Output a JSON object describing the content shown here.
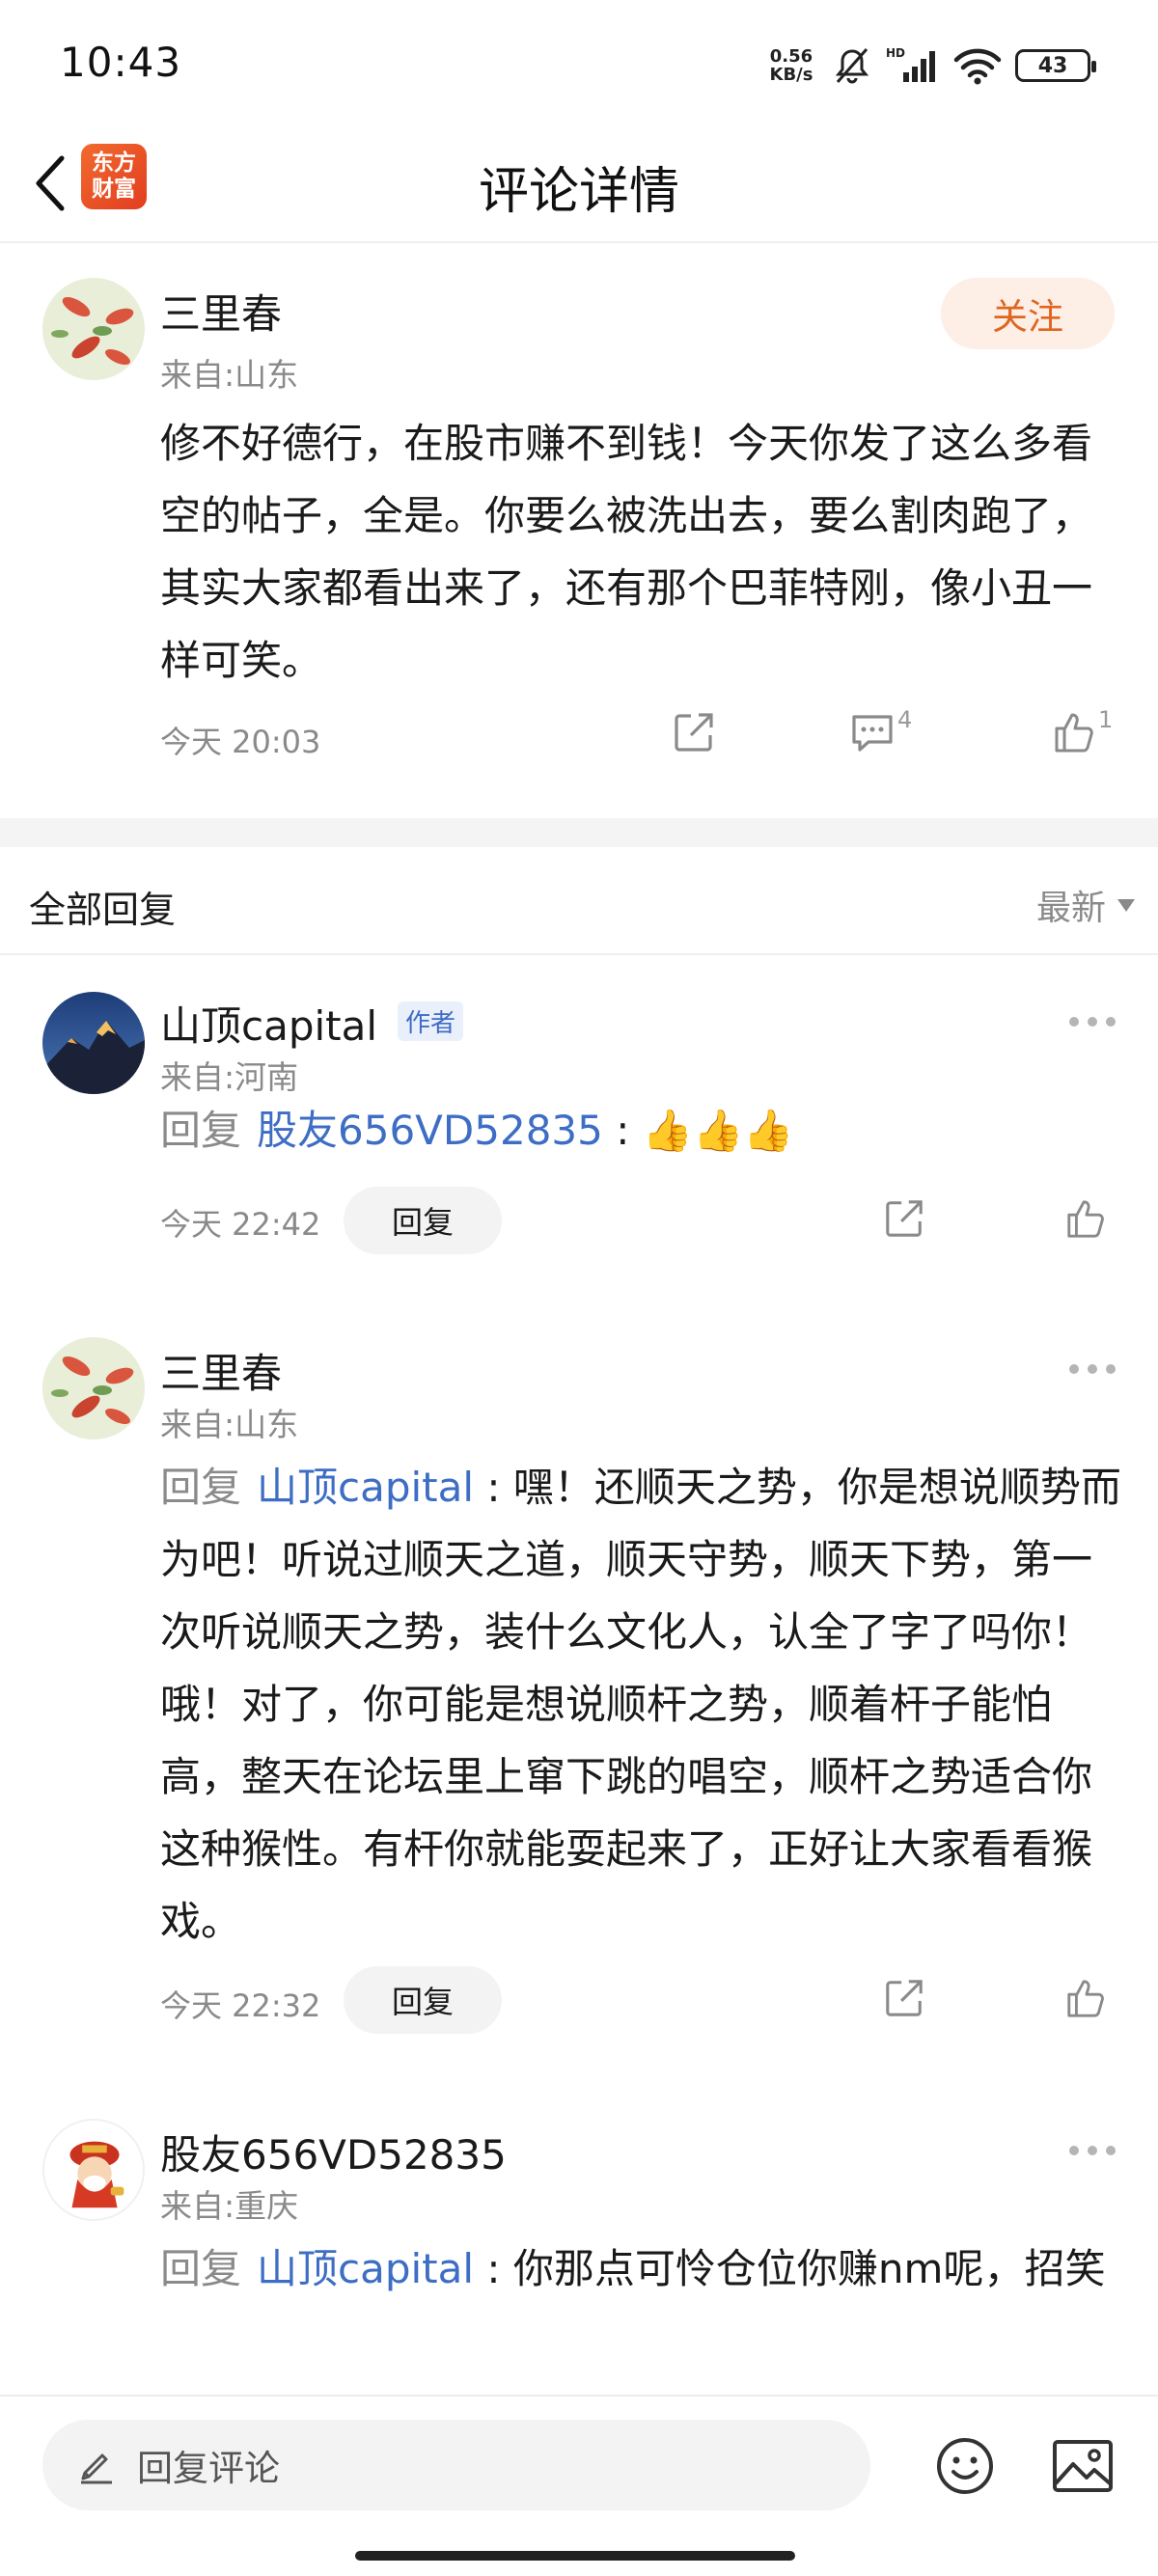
{
  "status": {
    "time": "10:43",
    "net_speed_value": "0.56",
    "net_speed_unit": "KB/s",
    "battery": "43"
  },
  "header": {
    "title": "评论详情",
    "logo_line1": "东方",
    "logo_line2": "财富"
  },
  "main_comment": {
    "author": "三里春",
    "location": "来自:山东",
    "follow_label": "关注",
    "text": "修不好德行，在股市赚不到钱！今天你发了这么多看空的帖子，全是。你要么被洗出去，要么割肉跑了，其实大家都看出来了，还有那个巴菲特刚，像小丑一样可笑。",
    "time": "今天 20:03",
    "comment_count": "4",
    "like_count": "1"
  },
  "replies_header": {
    "title": "全部回复",
    "sort_label": "最新"
  },
  "replies": [
    {
      "author": "山顶capital",
      "badge": "作者",
      "location": "来自:河南",
      "reply_word": "回复",
      "reply_to": "股友656VD52835",
      "content": "👍👍👍",
      "time": "今天 22:42",
      "reply_button": "回复"
    },
    {
      "author": "三里春",
      "location": "来自:山东",
      "reply_word": "回复",
      "reply_to": "山顶capital",
      "content": "嘿！还顺天之势，你是想说顺势而为吧！听说过顺天之道，顺天守势，顺天下势，第一次听说顺天之势，装什么文化人，认全了字了吗你！ 哦！对了，你可能是想说顺杆之势，顺着杆子能怕高，整天在论坛里上窜下跳的唱空，顺杆之势适合你这种猴性。有杆你就能耍起来了，正好让大家看看猴戏。",
      "time": "今天 22:32",
      "reply_button": "回复"
    },
    {
      "author": "股友656VD52835",
      "location": "来自:重庆",
      "reply_word": "回复",
      "reply_to": "山顶capital",
      "content": "你那点可怜仓位你赚nm呢，招笑"
    }
  ],
  "bottom": {
    "input_placeholder": "回复评论"
  }
}
